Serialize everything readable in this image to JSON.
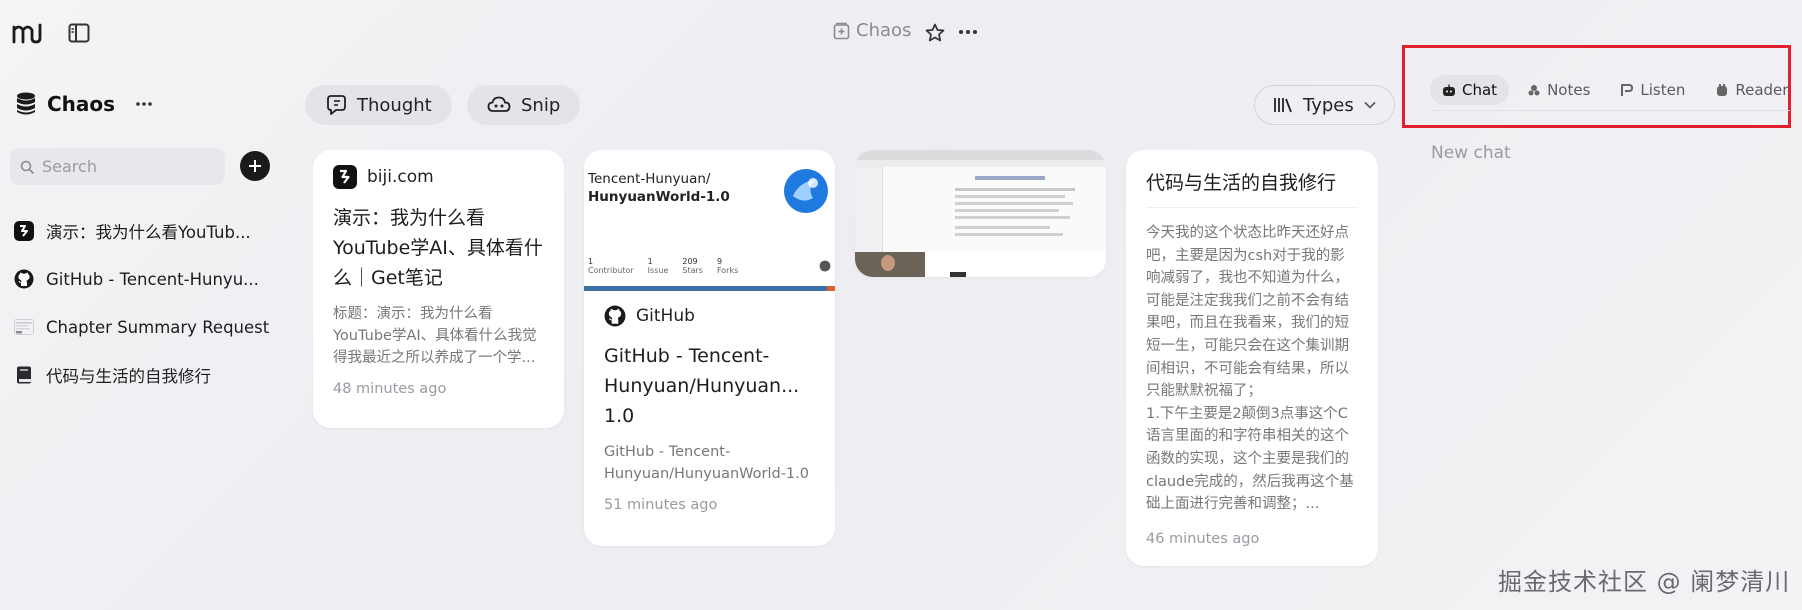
{
  "topbar": {
    "space_title": "Chaos"
  },
  "sidebar": {
    "space_name": "Chaos",
    "search_placeholder": "Search",
    "items": [
      {
        "label": "演示：我为什么看YouTub...",
        "icon": "biji-logo-icon"
      },
      {
        "label": "GitHub - Tencent-Hunyu...",
        "icon": "github-icon"
      },
      {
        "label": "Chapter Summary Request",
        "icon": "video-thumbnail-icon"
      },
      {
        "label": "代码与生活的自我修行",
        "icon": "notebook-icon"
      }
    ]
  },
  "toolbar": {
    "thought_label": "Thought",
    "snip_label": "Snip",
    "types_label": "Types"
  },
  "cards": [
    {
      "source": "biji.com",
      "title": "演示：我为什么看YouTube学AI、具体看什么｜Get笔记",
      "desc": "标题：演示：我为什么看YouTube学AI、具体看什么我觉得我最近之所以养成了一个学...",
      "time": "48 minutes ago"
    },
    {
      "preview_line1": "Tencent-Hunyuan/",
      "preview_line2": "HunyuanWorld-1.0",
      "stats": [
        {
          "value": "1",
          "label": "Contributor"
        },
        {
          "value": "1",
          "label": "Issue"
        },
        {
          "value": "209",
          "label": "Stars"
        },
        {
          "value": "9",
          "label": "Forks"
        }
      ],
      "source": "GitHub",
      "title": "GitHub - Tencent-Hunyuan/Hunyuan... 1.0",
      "desc": "GitHub - Tencent-Hunyuan/HunyuanWorld-1.0",
      "time": "51 minutes ago"
    },
    {
      "kind": "video-screenshot"
    },
    {
      "title": "代码与生活的自我修行",
      "body_p1": "今天我的这个状态比昨天还好点吧，主要是因为csh对于我的影响减弱了，我也不知道为什么，可能是注定我我们之前不会有结果吧，而且在我看来，我们的短短一生，可能只会在这个集训期间相识，不可能会有结果，所以只能默默祝福了；",
      "body_p2": "1.下午主要是2颠倒3点事这个C语言里面的和字符串相关的这个函数的实现，这个主要是我们的claude完成的，然后我再这个基础上面进行完善和调整；...",
      "time": "46 minutes ago"
    }
  ],
  "panel": {
    "tabs": [
      {
        "label": "Chat",
        "active": true
      },
      {
        "label": "Notes",
        "active": false
      },
      {
        "label": "Listen",
        "active": false
      },
      {
        "label": "Reader",
        "active": false
      }
    ],
    "new_chat_label": "New chat"
  },
  "watermark": "掘金技术社区 @ 阑梦清川"
}
